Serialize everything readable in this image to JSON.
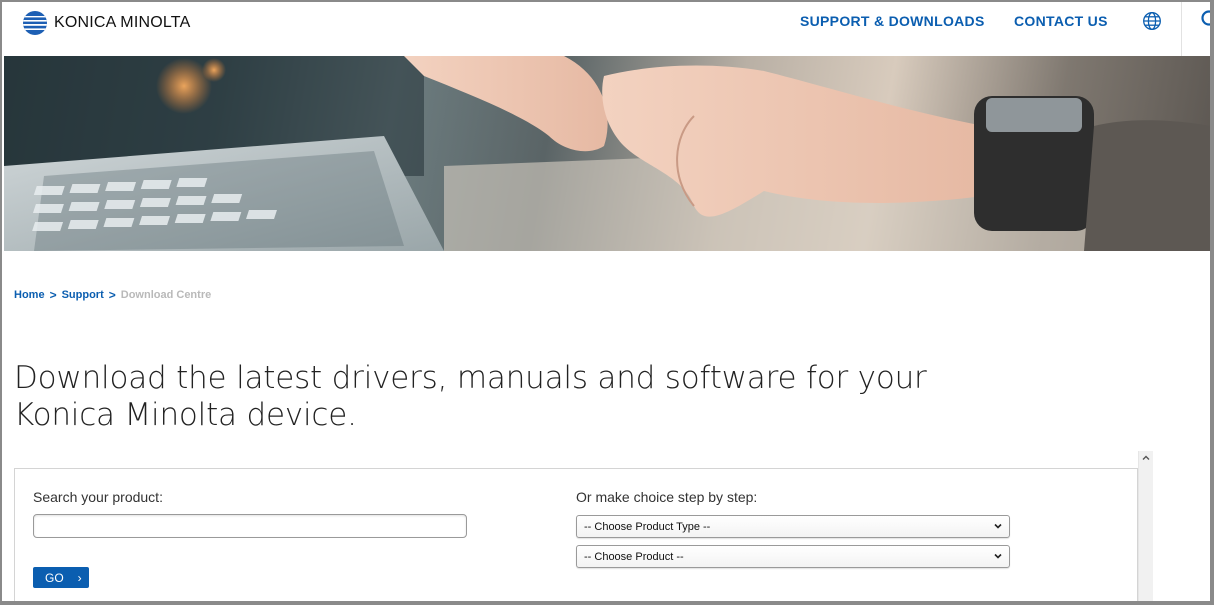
{
  "header": {
    "logo_text": "KONICA MINOLTA",
    "nav_support": "SUPPORT & DOWNLOADS",
    "nav_contact": "CONTACT US",
    "icons": [
      "globe-icon",
      "search-icon"
    ]
  },
  "breadcrumb": {
    "home": "Home",
    "separator": ">",
    "support": "Support",
    "current": "Download Centre"
  },
  "page": {
    "title": "Download the latest drivers, manuals and software for your Konica Minolta device."
  },
  "search_panel": {
    "search_label": "Search your product:",
    "search_value": "",
    "go_label": "GO",
    "choice_label": "Or make choice step by step:",
    "product_type_select": "-- Choose Product Type --",
    "product_select": "-- Choose Product --"
  },
  "colors": {
    "brand_blue": "#0b5eb0",
    "breadcrumb_current": "#b9b9b9",
    "text": "#222222"
  }
}
